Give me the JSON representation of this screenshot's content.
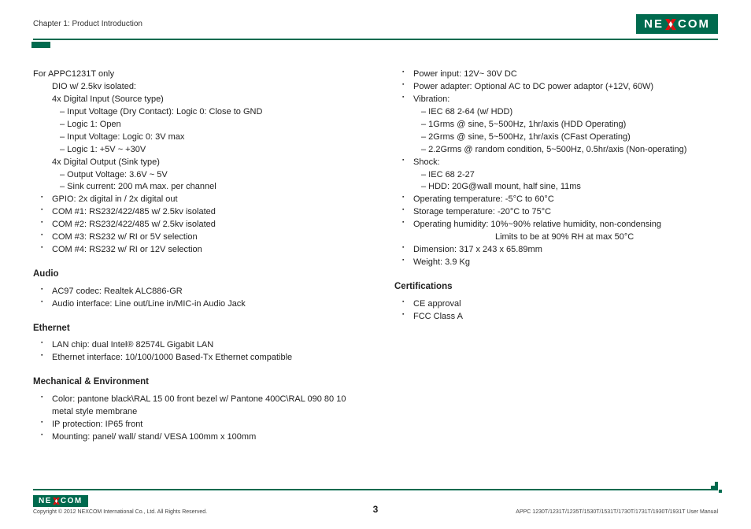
{
  "header": {
    "chapter": "Chapter 1: Product Introduction",
    "logo_left": "NE",
    "logo_right": "COM"
  },
  "left": {
    "intro": "For APPC1231T only",
    "dio_head": "DIO w/ 2.5kv isolated:",
    "di_head": "4x Digital Input (Source type)",
    "di1": "– Input Voltage (Dry Contact): Logic 0: Close to GND",
    "di2": "– Logic 1: Open",
    "di3": "– Input Voltage: Logic 0: 3V max",
    "di4": "– Logic 1: +5V ~ +30V",
    "do_head": "4x Digital Output (Sink type)",
    "do1": "– Output Voltage: 3.6V ~ 5V",
    "do2": "– Sink current: 200 mA max. per channel",
    "io_bullets": [
      "GPIO: 2x digital in / 2x digital out",
      "COM #1: RS232/422/485 w/ 2.5kv isolated",
      "COM #2: RS232/422/485 w/ 2.5kv isolated",
      "COM #3: RS232 w/ RI or 5V selection",
      "COM #4: RS232 w/ RI or 12V selection"
    ],
    "audio_head": "Audio",
    "audio": [
      "AC97 codec: Realtek ALC886-GR",
      "Audio interface: Line out/Line in/MIC-in Audio Jack"
    ],
    "eth_head": "Ethernet",
    "eth": [
      "LAN chip: dual Intel® 82574L Gigabit LAN",
      "Ethernet interface: 10/100/1000 Based-Tx Ethernet compatible"
    ],
    "mech_head": "Mechanical & Environment",
    "mech": [
      "Color: pantone black\\RAL 15 00 front bezel w/ Pantone 400C\\RAL 090 80 10 metal style membrane",
      "IP protection: IP65 front",
      "Mounting: panel/ wall/ stand/ VESA 100mm x 100mm"
    ]
  },
  "right": {
    "env": {
      "power_input": "Power input: 12V~ 30V DC",
      "power_adapter": "Power adapter: Optional AC to DC power adaptor (+12V, 60W)",
      "vib_head": "Vibration:",
      "vib": [
        "– IEC 68 2-64 (w/ HDD)",
        "– 1Grms @ sine, 5~500Hz, 1hr/axis (HDD Operating)",
        "– 2Grms @ sine, 5~500Hz, 1hr/axis (CFast Operating)",
        "– 2.2Grms @ random condition, 5~500Hz, 0.5hr/axis (Non-operating)"
      ],
      "shock_head": "Shock:",
      "shock": [
        "– IEC 68 2-27",
        "– HDD: 20G@wall mount, half sine, 11ms"
      ],
      "op_temp": "Operating temperature: -5°C to 60°C",
      "st_temp": "Storage temperature: -20°C to 75°C",
      "humidity1": "Operating humidity: 10%~90% relative humidity, non-condensing",
      "humidity2": "Limits to be at 90% RH at max 50°C",
      "dim": "Dimension: 317 x 243 x 65.89mm",
      "weight": "Weight: 3.9 Kg"
    },
    "cert_head": "Certifications",
    "cert": [
      "CE approval",
      "FCC Class A"
    ]
  },
  "footer": {
    "copyright": "Copyright © 2012 NEXCOM International Co., Ltd. All Rights Reserved.",
    "page": "3",
    "doc": "APPC 1230T/1231T/1235T/1530T/1531T/1730T/1731T/1930T/1931T User Manual"
  }
}
